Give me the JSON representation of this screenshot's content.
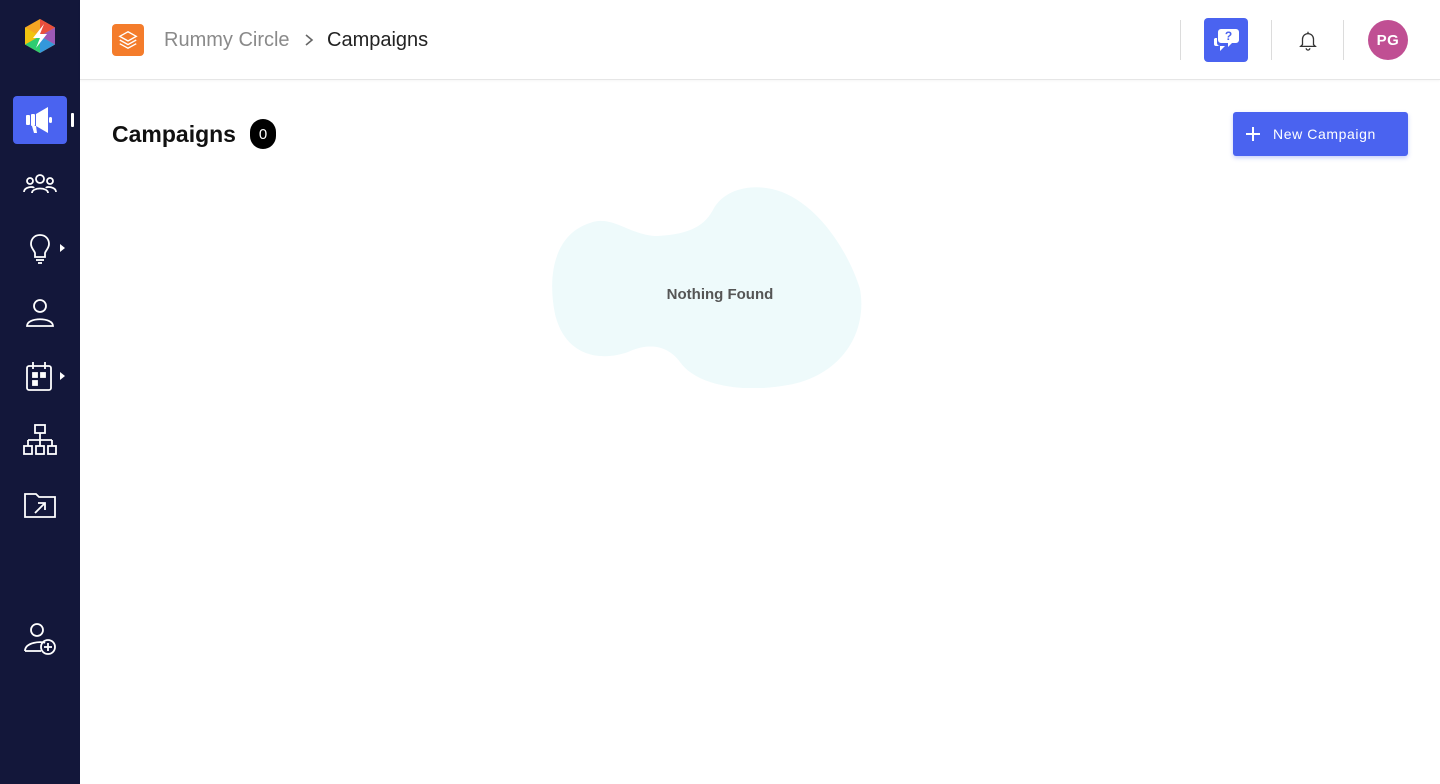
{
  "colors": {
    "sidebar_bg": "#13173a",
    "accent": "#4a63f0",
    "app_icon": "#f47c2b",
    "avatar": "#c04f93",
    "empty_blob": "#eefafb"
  },
  "sidebar": {
    "logo": "brand-logo",
    "items": [
      {
        "icon": "megaphone-icon",
        "active": true
      },
      {
        "icon": "users-group-icon"
      },
      {
        "icon": "lightbulb-icon",
        "has_submenu": true
      },
      {
        "icon": "user-icon"
      },
      {
        "icon": "calendar-icon",
        "has_submenu": true
      },
      {
        "icon": "hierarchy-icon"
      },
      {
        "icon": "folder-export-icon"
      }
    ],
    "bottom_item": {
      "icon": "add-user-icon"
    }
  },
  "header": {
    "app_name": "Rummy Circle",
    "page_name": "Campaigns",
    "avatar_initials": "PG"
  },
  "main": {
    "title": "Campaigns",
    "count": "0",
    "new_button_label": "New Campaign",
    "empty_state_text": "Nothing Found"
  }
}
